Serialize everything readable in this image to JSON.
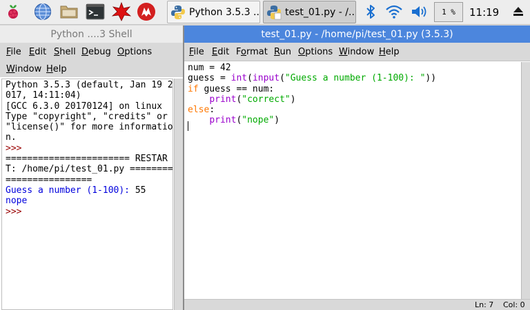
{
  "taskbar": {
    "launcher_icons": [
      "raspberry-icon",
      "globe-icon",
      "folder-icon",
      "terminal-icon",
      "mathematica-icon",
      "wolfram-icon"
    ],
    "tasks": [
      {
        "label": "Python 3.5.3 ..."
      },
      {
        "label": "test_01.py - /..."
      }
    ],
    "cpu": "1 %",
    "clock": "11:19"
  },
  "shell": {
    "title": "Python ....3 Shell",
    "menu": [
      {
        "label": "File",
        "u": "F"
      },
      {
        "label": "Edit",
        "u": "E"
      },
      {
        "label": "Shell",
        "u": "S"
      },
      {
        "label": "Debug",
        "u": "D"
      },
      {
        "label": "Options",
        "u": "O"
      },
      {
        "label": "Window",
        "u": "W"
      },
      {
        "label": "Help",
        "u": "H"
      }
    ],
    "lines": [
      {
        "text": "Python 3.5.3 (default, Jan 19 2",
        "color": "#000000"
      },
      {
        "text": "017, 14:11:04)",
        "color": "#000000"
      },
      {
        "text": "[GCC 6.3.0 20170124] on linux",
        "color": "#000000"
      },
      {
        "text": "Type \"copyright\", \"credits\" or",
        "color": "#000000"
      },
      {
        "text": "\"license()\" for more informatio",
        "color": "#000000"
      },
      {
        "text": "n.",
        "color": "#000000"
      },
      {
        "text": ">>>",
        "color": "#990000"
      },
      {
        "text": "======================= RESTAR",
        "color": "#000000"
      },
      {
        "text": "T: /home/pi/test_01.py ========",
        "color": "#000000"
      },
      {
        "text": "================",
        "color": "#000000"
      },
      {
        "text": "Guess a number (1-100): ",
        "color": "#0000dd",
        "suffix": "55"
      },
      {
        "text": "nope",
        "color": "#0000dd"
      },
      {
        "text": ">>>",
        "color": "#990000"
      }
    ]
  },
  "editor": {
    "title": "test_01.py - /home/pi/test_01.py (3.5.3)",
    "menu": [
      {
        "label": "File",
        "u": "F"
      },
      {
        "label": "Edit",
        "u": "E"
      },
      {
        "label": "Format",
        "u": "o"
      },
      {
        "label": "Run",
        "u": "R"
      },
      {
        "label": "Options",
        "u": "O"
      },
      {
        "label": "Window",
        "u": "W"
      },
      {
        "label": "Help",
        "u": "H"
      }
    ],
    "code": [
      [
        {
          "t": "num = 42",
          "c": "#000000"
        }
      ],
      [
        {
          "t": "guess = ",
          "c": "#000000"
        },
        {
          "t": "int",
          "c": "#9900cc"
        },
        {
          "t": "(",
          "c": "#000000"
        },
        {
          "t": "input",
          "c": "#9900cc"
        },
        {
          "t": "(",
          "c": "#000000"
        },
        {
          "t": "\"Guess a number (1-100): \"",
          "c": "#00aa00"
        },
        {
          "t": "))",
          "c": "#000000"
        }
      ],
      [
        {
          "t": "if",
          "c": "#ff7700"
        },
        {
          "t": " guess == num:",
          "c": "#000000"
        }
      ],
      [
        {
          "t": "    ",
          "c": "#000000"
        },
        {
          "t": "print",
          "c": "#9900cc"
        },
        {
          "t": "(",
          "c": "#000000"
        },
        {
          "t": "\"correct\"",
          "c": "#00aa00"
        },
        {
          "t": ")",
          "c": "#000000"
        }
      ],
      [
        {
          "t": "else",
          "c": "#ff7700"
        },
        {
          "t": ":",
          "c": "#000000"
        }
      ],
      [
        {
          "t": "    ",
          "c": "#000000"
        },
        {
          "t": "print",
          "c": "#9900cc"
        },
        {
          "t": "(",
          "c": "#000000"
        },
        {
          "t": "\"nope\"",
          "c": "#00aa00"
        },
        {
          "t": ")",
          "c": "#000000"
        }
      ]
    ],
    "status": {
      "line": "Ln: 7",
      "col": "Col: 0"
    }
  }
}
